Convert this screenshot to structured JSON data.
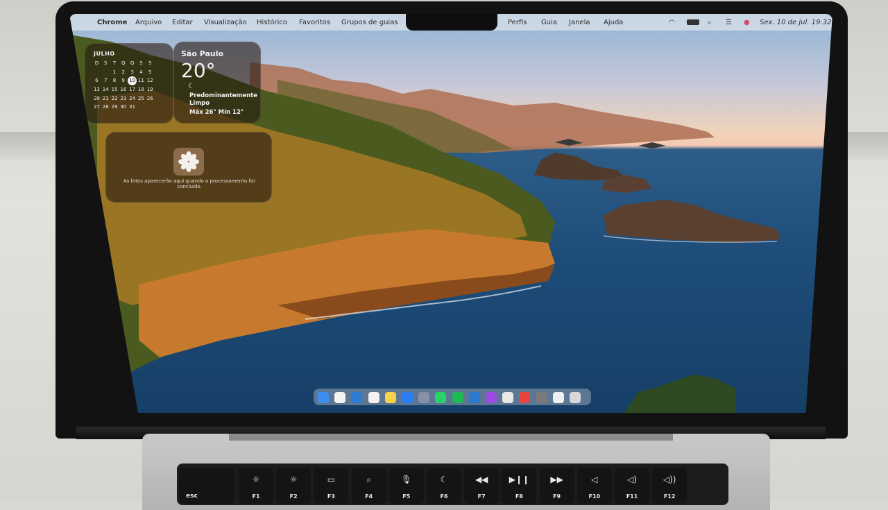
{
  "menubar": {
    "app_name": "Chrome",
    "items": [
      "Arquivo",
      "Editar",
      "Visualização",
      "Histórico",
      "Favoritos",
      "Grupos de guias",
      "Perfis",
      "Guia",
      "Janela",
      "Ajuda"
    ],
    "datetime": "Sex. 10 de jul.  19:32"
  },
  "calendar": {
    "month": "JULHO",
    "weekdays": [
      "D",
      "S",
      "T",
      "Q",
      "Q",
      "S",
      "S"
    ],
    "days": [
      "",
      "",
      "1",
      "2",
      "3",
      "4",
      "5",
      "6",
      "7",
      "8",
      "9",
      "10",
      "11",
      "12",
      "13",
      "14",
      "15",
      "16",
      "17",
      "18",
      "19",
      "20",
      "21",
      "22",
      "23",
      "24",
      "25",
      "26",
      "27",
      "28",
      "29",
      "30",
      "31"
    ],
    "today": "10"
  },
  "weather": {
    "city": "São Paulo",
    "temperature": "20°",
    "condition": "Predominantemente Limpo",
    "range": "Máx 26° Mín 12°"
  },
  "photos_widget": {
    "message": "As fotos aparecerão aqui quando o processamento for concluído."
  },
  "keyboard": {
    "esc": "esc",
    "fkeys": [
      "F1",
      "F2",
      "F3",
      "F4",
      "F5",
      "F6",
      "F7",
      "F8",
      "F9",
      "F10",
      "F11",
      "F12"
    ],
    "glyphs": [
      "☼",
      "☼",
      "▭",
      "⌕",
      "🎙",
      "☾",
      "◀◀",
      "▶❙❙",
      "▶▶",
      "◁",
      "◁)",
      "◁))"
    ]
  },
  "dock_icon_names": [
    "finder-icon",
    "calendar-icon",
    "safari-icon",
    "calendar-date-icon",
    "notes-icon",
    "app-store-icon",
    "launchpad-icon",
    "whatsapp-icon",
    "spotify-icon",
    "vscode-icon",
    "podcasts-icon",
    "chrome-icon",
    "photo-booth-icon",
    "calculator-icon",
    "documents-icon",
    "trash-icon"
  ]
}
